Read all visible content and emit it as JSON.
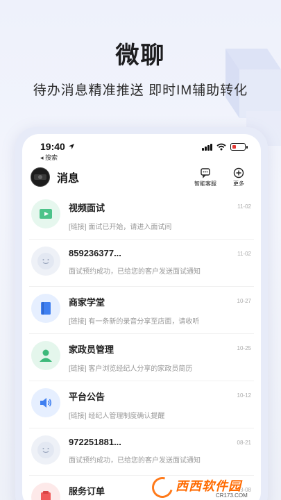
{
  "hero": {
    "title": "微聊",
    "subtitle": "待办消息精准推送  即时IM辅助转化"
  },
  "status_bar": {
    "time": "19:40",
    "back_label": "◂ 搜索"
  },
  "header": {
    "title": "消息",
    "actions": [
      {
        "label": "智能客服",
        "icon": "customer-service-icon"
      },
      {
        "label": "更多",
        "icon": "plus-circle-icon"
      }
    ]
  },
  "messages": [
    {
      "title": "视频面试",
      "preview": "[链接] 面试已开始，请进入面试间",
      "date": "11-02",
      "icon": "video-icon",
      "color": "#4cc38a",
      "bg": "#e6f7ee"
    },
    {
      "title": "859236377...",
      "preview": "面试预约成功，已给您的客户发送面试通知",
      "date": "11-02",
      "icon": "default-avatar-icon",
      "color": "#b9c3d6",
      "bg": "#eef1f7"
    },
    {
      "title": "商家学堂",
      "preview": "[链接] 有一条新的录音分享至店面，请收听",
      "date": "10-27",
      "icon": "book-icon",
      "color": "#3f7ff0",
      "bg": "#e6efff"
    },
    {
      "title": "家政员管理",
      "preview": "[链接] 客户浏览经纪人分享的家政员简历",
      "date": "10-25",
      "icon": "person-icon",
      "color": "#3cb97a",
      "bg": "#e4f6ec"
    },
    {
      "title": "平台公告",
      "preview": "[链接] 经纪人管理制度确认提醒",
      "date": "10-12",
      "icon": "speaker-icon",
      "color": "#3f7ff0",
      "bg": "#e6efff"
    },
    {
      "title": "972251881...",
      "preview": "面试预约成功，已给您的客户发送面试通知",
      "date": "08-21",
      "icon": "default-avatar-icon",
      "color": "#b9c3d6",
      "bg": "#eef1f7"
    },
    {
      "title": "服务订单",
      "preview": "",
      "date": "08-08",
      "icon": "order-icon",
      "color": "#f05a5a",
      "bg": "#fde9e9"
    }
  ],
  "watermark": {
    "brand": "西西软件园",
    "url": "CR173.COM"
  }
}
